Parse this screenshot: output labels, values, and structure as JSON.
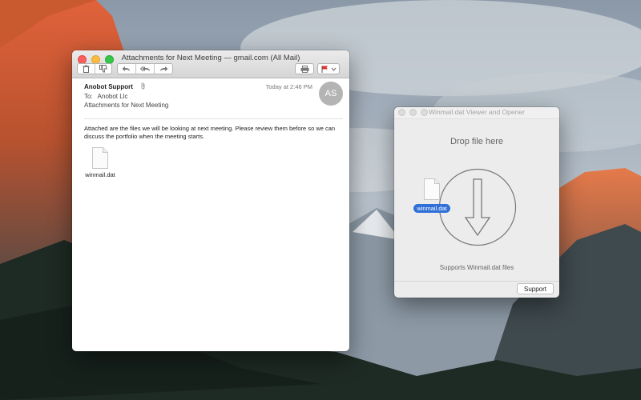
{
  "mail_window": {
    "title": "Attachments for Next Meeting — gmail.com (All Mail)",
    "toolbar": {
      "delete_icon": "trash-icon",
      "junk_icon": "thumbs-down-icon",
      "reply_icon": "reply-icon",
      "reply_all_icon": "reply-all-icon",
      "forward_icon": "forward-icon",
      "print_icon": "printer-icon",
      "flag_icon": "flag-icon",
      "flag_color": "#e0322b"
    },
    "message": {
      "sender": "Anobot Support",
      "date": "Today at 2:46 PM",
      "to_label": "To:",
      "to_value": "Anobot Llc",
      "subject": "Attachments for Next Meeting",
      "avatar_initials": "AS",
      "body": "Attached are the files we will be looking at next meeting. Please review them before so we can discuss the portfolio when the meeting starts.",
      "attachment_name": "winmail.dat"
    }
  },
  "winmail_window": {
    "title": "Winmail.dat Viewer and Opener",
    "drop_text": "Drop file here",
    "dragged_file_name": "winmail.dat",
    "supports_text": "Supports Winmail.dat files",
    "support_button": "Support",
    "badge_color": "#2f6fd7"
  }
}
